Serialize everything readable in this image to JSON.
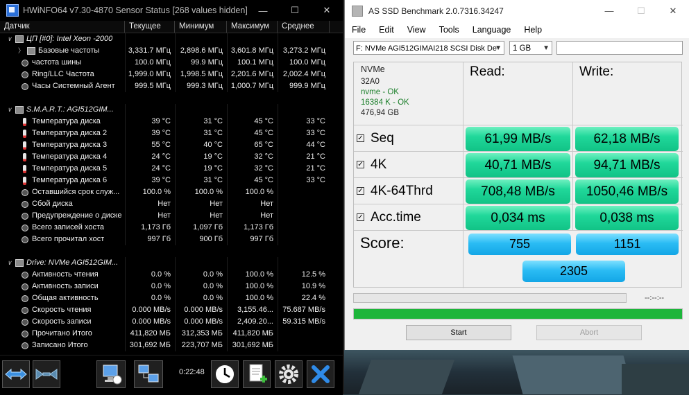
{
  "hwinfo": {
    "title": "HWiNFO64 v7.30-4870 Sensor Status [268 values hidden]",
    "columns": [
      "Датчик",
      "Текущее",
      "Минимум",
      "Максимум",
      "Среднее"
    ],
    "groups": [
      {
        "name": "ЦП [#0]: Intel Xeon -2000",
        "rows": [
          {
            "label": "Базовые частоты",
            "cur": "3,331.7 МГц",
            "min": "2,898.6 МГц",
            "max": "3,601.8 МГц",
            "avg": "3,273.2 МГц",
            "icon": "chip-icon",
            "sub": true
          },
          {
            "label": "частота шины",
            "cur": "100.0 МГц",
            "min": "99.9 МГц",
            "max": "100.1 МГц",
            "avg": "100.0 МГц",
            "icon": "clock-icon"
          },
          {
            "label": "Ring/LLC Частота",
            "cur": "1,999.0 МГц",
            "min": "1,998.5 МГц",
            "max": "2,201.6 МГц",
            "avg": "2,002.4 МГц",
            "icon": "clock-icon"
          },
          {
            "label": "Часы Системный Агент",
            "cur": "999.5 МГц",
            "min": "999.3 МГц",
            "max": "1,000.7 МГц",
            "avg": "999.9 МГц",
            "icon": "clock-icon"
          }
        ]
      },
      {
        "name": "S.M.A.R.T.: AGI512GIM...",
        "rows": [
          {
            "label": "Температура диска",
            "cur": "39 °C",
            "min": "31 °C",
            "max": "45 °C",
            "avg": "33 °C",
            "icon": "thermometer-icon"
          },
          {
            "label": "Температура диска 2",
            "cur": "39 °C",
            "min": "31 °C",
            "max": "45 °C",
            "avg": "33 °C",
            "icon": "thermometer-icon"
          },
          {
            "label": "Температура диска 3",
            "cur": "55 °C",
            "min": "40 °C",
            "max": "65 °C",
            "avg": "44 °C",
            "icon": "thermometer-icon"
          },
          {
            "label": "Температура диска 4",
            "cur": "24 °C",
            "min": "19 °C",
            "max": "32 °C",
            "avg": "21 °C",
            "icon": "thermometer-icon"
          },
          {
            "label": "Температура диска 5",
            "cur": "24 °C",
            "min": "19 °C",
            "max": "32 °C",
            "avg": "21 °C",
            "icon": "thermometer-icon"
          },
          {
            "label": "Температура диска 6",
            "cur": "39 °C",
            "min": "31 °C",
            "max": "45 °C",
            "avg": "33 °C",
            "icon": "thermometer-icon"
          },
          {
            "label": "Оставшийся срок служ...",
            "cur": "100.0 %",
            "min": "100.0 %",
            "max": "100.0 %",
            "avg": "",
            "icon": "clock-icon"
          },
          {
            "label": "Сбой диска",
            "cur": "Нет",
            "min": "Нет",
            "max": "Нет",
            "avg": "",
            "icon": "clock-icon"
          },
          {
            "label": "Предупреждение о диске",
            "cur": "Нет",
            "min": "Нет",
            "max": "Нет",
            "avg": "",
            "icon": "clock-icon"
          },
          {
            "label": "Всего записей хоста",
            "cur": "1,173 Гб",
            "min": "1,097 Гб",
            "max": "1,173 Гб",
            "avg": "",
            "icon": "clock-icon"
          },
          {
            "label": "Всего прочитал хост",
            "cur": "997 Гб",
            "min": "900 Гб",
            "max": "997 Гб",
            "avg": "",
            "icon": "clock-icon"
          }
        ]
      },
      {
        "name": "Drive: NVMe AGI512GIM...",
        "rows": [
          {
            "label": "Активность чтения",
            "cur": "0.0 %",
            "min": "0.0 %",
            "max": "100.0 %",
            "avg": "12.5 %",
            "icon": "clock-icon"
          },
          {
            "label": "Активность записи",
            "cur": "0.0 %",
            "min": "0.0 %",
            "max": "100.0 %",
            "avg": "10.9 %",
            "icon": "clock-icon"
          },
          {
            "label": "Общая активность",
            "cur": "0.0 %",
            "min": "0.0 %",
            "max": "100.0 %",
            "avg": "22.4 %",
            "icon": "clock-icon"
          },
          {
            "label": "Скорость чтения",
            "cur": "0.000 MB/s",
            "min": "0.000 MB/s",
            "max": "3,155.46...",
            "avg": "75.687 MB/s",
            "icon": "clock-icon"
          },
          {
            "label": "Скорость записи",
            "cur": "0.000 MB/s",
            "min": "0.000 MB/s",
            "max": "2,409.20...",
            "avg": "59.315 MB/s",
            "icon": "clock-icon"
          },
          {
            "label": "Прочитано Итого",
            "cur": "411,820 МБ",
            "min": "312,353 МБ",
            "max": "411,820 МБ",
            "avg": "",
            "icon": "clock-icon"
          },
          {
            "label": "Записано Итого",
            "cur": "301,692 МБ",
            "min": "223,707 МБ",
            "max": "301,692 МБ",
            "avg": "",
            "icon": "clock-icon"
          }
        ]
      }
    ],
    "timer": "0:22:48"
  },
  "asssd": {
    "title": "AS SSD Benchmark 2.0.7316.34247",
    "menu": [
      "File",
      "Edit",
      "View",
      "Tools",
      "Language",
      "Help"
    ],
    "drive_select": "F: NVMe AGI512GIMAI218 SCSI Disk De",
    "size_select": "1 GB",
    "info": {
      "type": "NVMe",
      "firmware": "32A0",
      "driver": "nvme - OK",
      "alignment": "16384 K - OK",
      "capacity": "476,94 GB"
    },
    "read_header": "Read:",
    "write_header": "Write:",
    "tests": [
      {
        "label": "Seq",
        "read": "61,99 MB/s",
        "write": "62,18 MB/s",
        "checked": true
      },
      {
        "label": "4K",
        "read": "40,71 MB/s",
        "write": "94,71 MB/s",
        "checked": true
      },
      {
        "label": "4K-64Thrd",
        "read": "708,48 MB/s",
        "write": "1050,46 MB/s",
        "checked": true
      },
      {
        "label": "Acc.time",
        "read": "0,034 ms",
        "write": "0,038 ms",
        "checked": true
      }
    ],
    "score_label": "Score:",
    "score_read": "755",
    "score_write": "1151",
    "score_total": "2305",
    "elapsed": "--:--:--",
    "progress": 1.0,
    "start_label": "Start",
    "abort_label": "Abort",
    "colors": {
      "result_green": "#20d89a",
      "score_blue": "#2bbcf4",
      "progress_green": "#1db53a"
    }
  }
}
